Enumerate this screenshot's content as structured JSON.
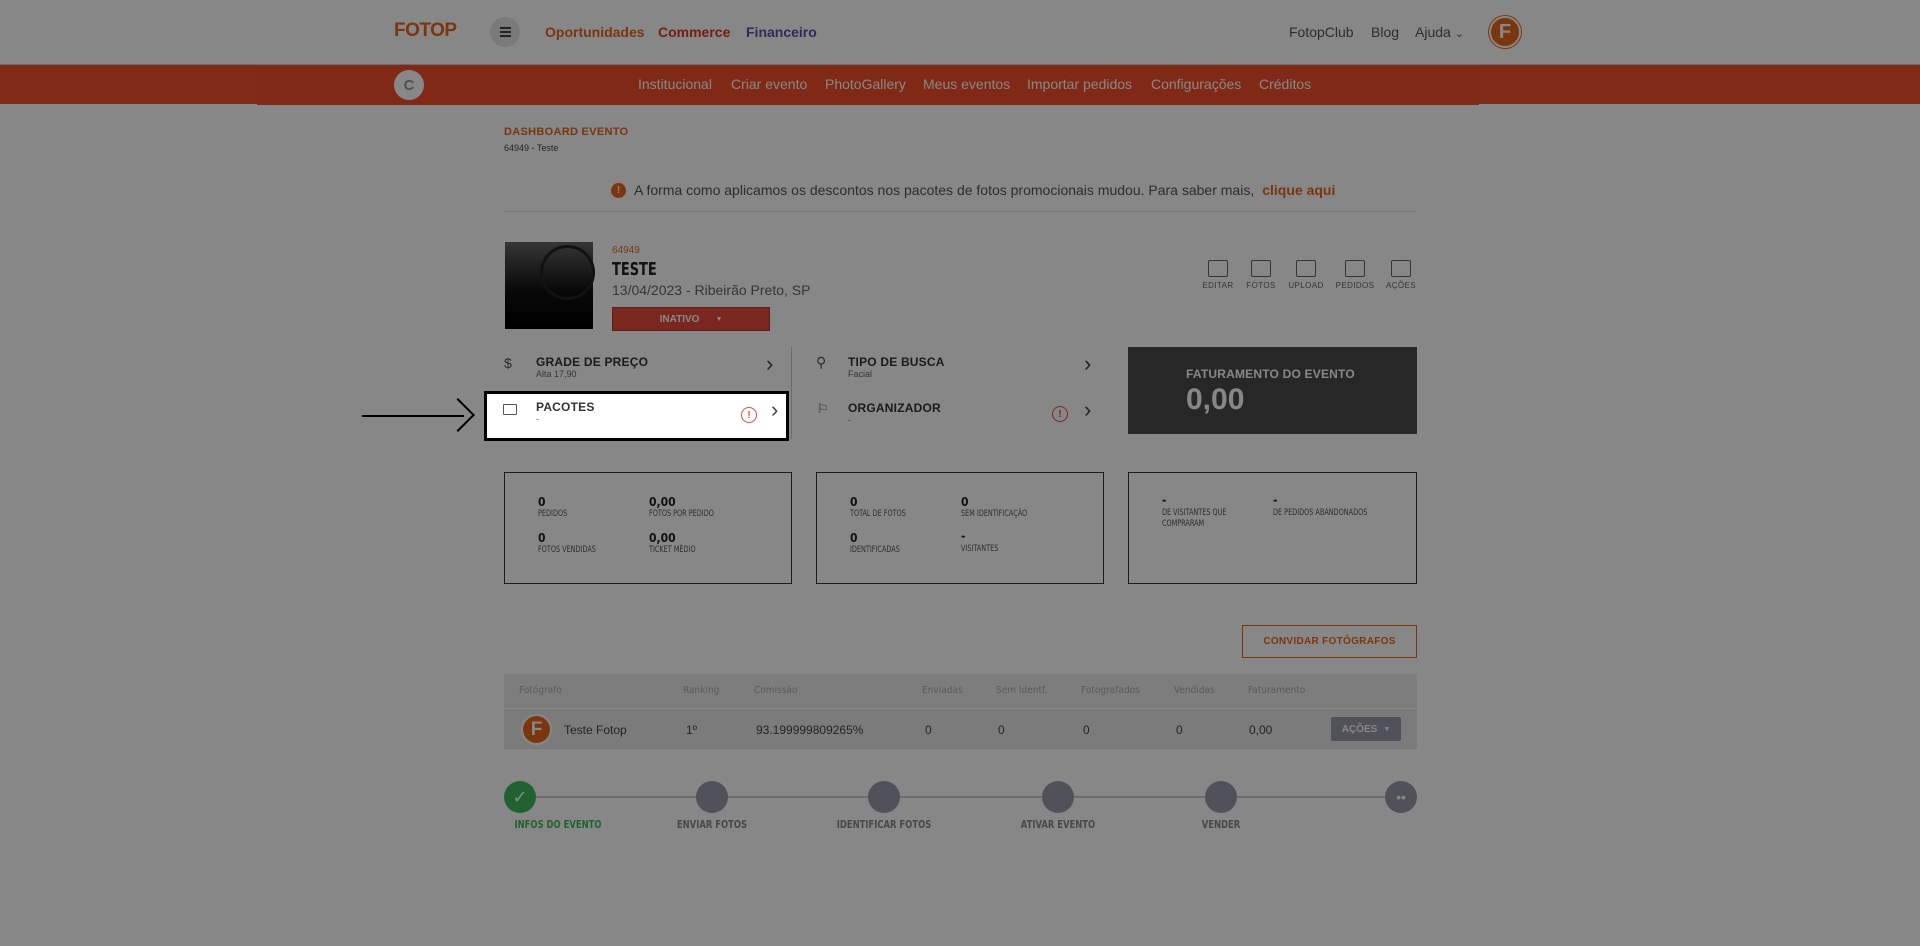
{
  "topnav": {
    "logo": "FOTOP",
    "links": [
      {
        "label": "Oportunidades",
        "color": "#e8661e"
      },
      {
        "label": "Commerce",
        "color": "#d9391c"
      },
      {
        "label": "Financeiro",
        "color": "#5b4fa8"
      }
    ],
    "right_links": [
      "FotopClub",
      "Blog",
      "Ajuda"
    ],
    "avatar_letter": "F"
  },
  "subnav": {
    "badge_letter": "C",
    "links": [
      "Institucional",
      "Criar evento",
      "PhotoGallery",
      "Meus eventos",
      "Importar pedidos",
      "Configurações",
      "Créditos"
    ]
  },
  "dashboard": {
    "title": "DASHBOARD EVENTO",
    "subtitle": "64949 - Teste"
  },
  "notice": {
    "text": "A forma como aplicamos os descontos nos pacotes de fotos promocionais mudou. Para saber mais,",
    "link": "clique aqui"
  },
  "event": {
    "id": "64949",
    "name": "TESTE",
    "date_location": "13/04/2023 - Ribeirão Preto, SP",
    "status": "INATIVO",
    "actions": [
      "EDITAR",
      "FOTOS",
      "UPLOAD",
      "PEDIDOS",
      "AÇÕES"
    ]
  },
  "info_rows": {
    "grade": {
      "label": "GRADE DE PREÇO",
      "value": "Alta 17,90"
    },
    "pacotes": {
      "label": "PACOTES",
      "value": "-"
    },
    "busca": {
      "label": "TIPO DE BUSCA",
      "value": "Facial"
    },
    "organizador": {
      "label": "ORGANIZADOR",
      "value": "-"
    }
  },
  "revenue": {
    "label": "FATURAMENTO DO EVENTO",
    "value": "0,00"
  },
  "stats": {
    "box1": [
      {
        "value": "0",
        "label": "PEDIDOS"
      },
      {
        "value": "0,00",
        "label": "FOTOS POR PEDIDO"
      },
      {
        "value": "0",
        "label": "FOTOS VENDIDAS"
      },
      {
        "value": "0,00",
        "label": "TICKET MÉDIO"
      }
    ],
    "box2": [
      {
        "value": "0",
        "label": "TOTAL DE FOTOS"
      },
      {
        "value": "0",
        "label": "SEM IDENTIFICAÇÃO"
      },
      {
        "value": "0",
        "label": "IDENTIFICADAS"
      },
      {
        "value": "-",
        "label": "VISITANTES"
      }
    ],
    "box3": [
      {
        "value": "-",
        "label": "DE VISITANTES QUE COMPRARAM"
      },
      {
        "value": "-",
        "label": "DE PEDIDOS ABANDONADOS"
      }
    ]
  },
  "invite_button": "CONVIDAR FOTÓGRAFOS",
  "table": {
    "headers": [
      "Fotógrafo",
      "Ranking",
      "Comissão",
      "Enviadas",
      "Sem Identf.",
      "Fotografados",
      "Vendidas",
      "Faturamento"
    ],
    "row": {
      "avatar_letter": "F",
      "name": "Teste Fotop",
      "ranking": "1º",
      "comissao": "93.199999809265%",
      "enviadas": "0",
      "sem_ident": "0",
      "fotografados": "0",
      "vendidas": "0",
      "faturamento": "0,00",
      "actions_label": "AÇÕES"
    }
  },
  "steps": [
    "INFOS DO EVENTO",
    "ENVIAR FOTOS",
    "IDENTIFICAR FOTOS",
    "ATIVAR EVENTO",
    "VENDER"
  ],
  "colors": {
    "brand": "#e8661e",
    "subnav": "#f04e2b",
    "success": "#3db85a",
    "danger": "#e74c3c"
  }
}
